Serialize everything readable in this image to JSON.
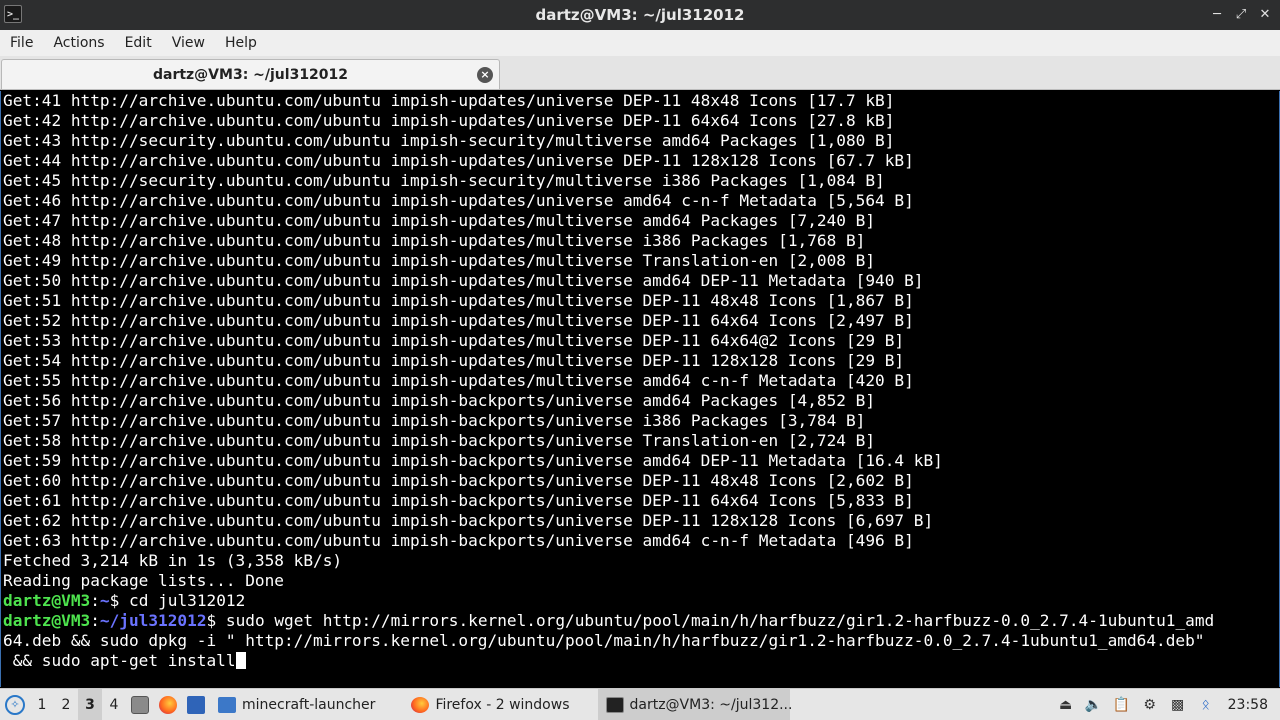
{
  "window": {
    "title": "dartz@VM3: ~/jul312012",
    "controls": {
      "minimize": "▁",
      "maximize": "✕",
      "close": "✕"
    }
  },
  "menu": [
    "File",
    "Actions",
    "Edit",
    "View",
    "Help"
  ],
  "tab": {
    "label": "dartz@VM3: ~/jul312012",
    "close_glyph": "×"
  },
  "terminal": {
    "output_lines": [
      "Get:41 http://archive.ubuntu.com/ubuntu impish-updates/universe DEP-11 48x48 Icons [17.7 kB]",
      "Get:42 http://archive.ubuntu.com/ubuntu impish-updates/universe DEP-11 64x64 Icons [27.8 kB]",
      "Get:43 http://security.ubuntu.com/ubuntu impish-security/multiverse amd64 Packages [1,080 B]",
      "Get:44 http://archive.ubuntu.com/ubuntu impish-updates/universe DEP-11 128x128 Icons [67.7 kB]",
      "Get:45 http://security.ubuntu.com/ubuntu impish-security/multiverse i386 Packages [1,084 B]",
      "Get:46 http://archive.ubuntu.com/ubuntu impish-updates/universe amd64 c-n-f Metadata [5,564 B]",
      "Get:47 http://archive.ubuntu.com/ubuntu impish-updates/multiverse amd64 Packages [7,240 B]",
      "Get:48 http://archive.ubuntu.com/ubuntu impish-updates/multiverse i386 Packages [1,768 B]",
      "Get:49 http://archive.ubuntu.com/ubuntu impish-updates/multiverse Translation-en [2,008 B]",
      "Get:50 http://archive.ubuntu.com/ubuntu impish-updates/multiverse amd64 DEP-11 Metadata [940 B]",
      "Get:51 http://archive.ubuntu.com/ubuntu impish-updates/multiverse DEP-11 48x48 Icons [1,867 B]",
      "Get:52 http://archive.ubuntu.com/ubuntu impish-updates/multiverse DEP-11 64x64 Icons [2,497 B]",
      "Get:53 http://archive.ubuntu.com/ubuntu impish-updates/multiverse DEP-11 64x64@2 Icons [29 B]",
      "Get:54 http://archive.ubuntu.com/ubuntu impish-updates/multiverse DEP-11 128x128 Icons [29 B]",
      "Get:55 http://archive.ubuntu.com/ubuntu impish-updates/multiverse amd64 c-n-f Metadata [420 B]",
      "Get:56 http://archive.ubuntu.com/ubuntu impish-backports/universe amd64 Packages [4,852 B]",
      "Get:57 http://archive.ubuntu.com/ubuntu impish-backports/universe i386 Packages [3,784 B]",
      "Get:58 http://archive.ubuntu.com/ubuntu impish-backports/universe Translation-en [2,724 B]",
      "Get:59 http://archive.ubuntu.com/ubuntu impish-backports/universe amd64 DEP-11 Metadata [16.4 kB]",
      "Get:60 http://archive.ubuntu.com/ubuntu impish-backports/universe DEP-11 48x48 Icons [2,602 B]",
      "Get:61 http://archive.ubuntu.com/ubuntu impish-backports/universe DEP-11 64x64 Icons [5,833 B]",
      "Get:62 http://archive.ubuntu.com/ubuntu impish-backports/universe DEP-11 128x128 Icons [6,697 B]",
      "Get:63 http://archive.ubuntu.com/ubuntu impish-backports/universe amd64 c-n-f Metadata [496 B]",
      "Fetched 3,214 kB in 1s (3,358 kB/s)",
      "Reading package lists... Done"
    ],
    "prompt1": {
      "user": "dartz@VM3",
      "sep": ":",
      "path": "~",
      "suffix": "$ ",
      "command": "cd jul312012"
    },
    "prompt2": {
      "user": "dartz@VM3",
      "sep": ":",
      "path": "~/jul312012",
      "suffix": "$ ",
      "command_line1": "sudo wget http://mirrors.kernel.org/ubuntu/pool/main/h/harfbuzz/gir1.2-harfbuzz-0.0_2.7.4-1ubuntu1_amd",
      "command_line2": "64.deb && sudo dpkg -i \" http://mirrors.kernel.org/ubuntu/pool/main/h/harfbuzz/gir1.2-harfbuzz-0.0_2.7.4-1ubuntu1_amd64.deb\"",
      "command_line3": " && sudo apt-get install"
    }
  },
  "taskbar": {
    "workspaces": [
      "1",
      "2",
      "3",
      "4"
    ],
    "active_workspace": "3",
    "tasks": [
      {
        "label": "minecraft-launcher",
        "icon": "folder-icon"
      },
      {
        "label": "Firefox - 2 windows",
        "icon": "firefox-icon"
      },
      {
        "label": "dartz@VM3: ~/jul312...",
        "icon": "terminal-icon"
      }
    ],
    "clock": "23:58"
  },
  "colors": {
    "prompt_user": "#4ee44e",
    "prompt_path": "#6a73ff",
    "terminal_bg": "#000000",
    "terminal_fg": "#ffffff"
  }
}
